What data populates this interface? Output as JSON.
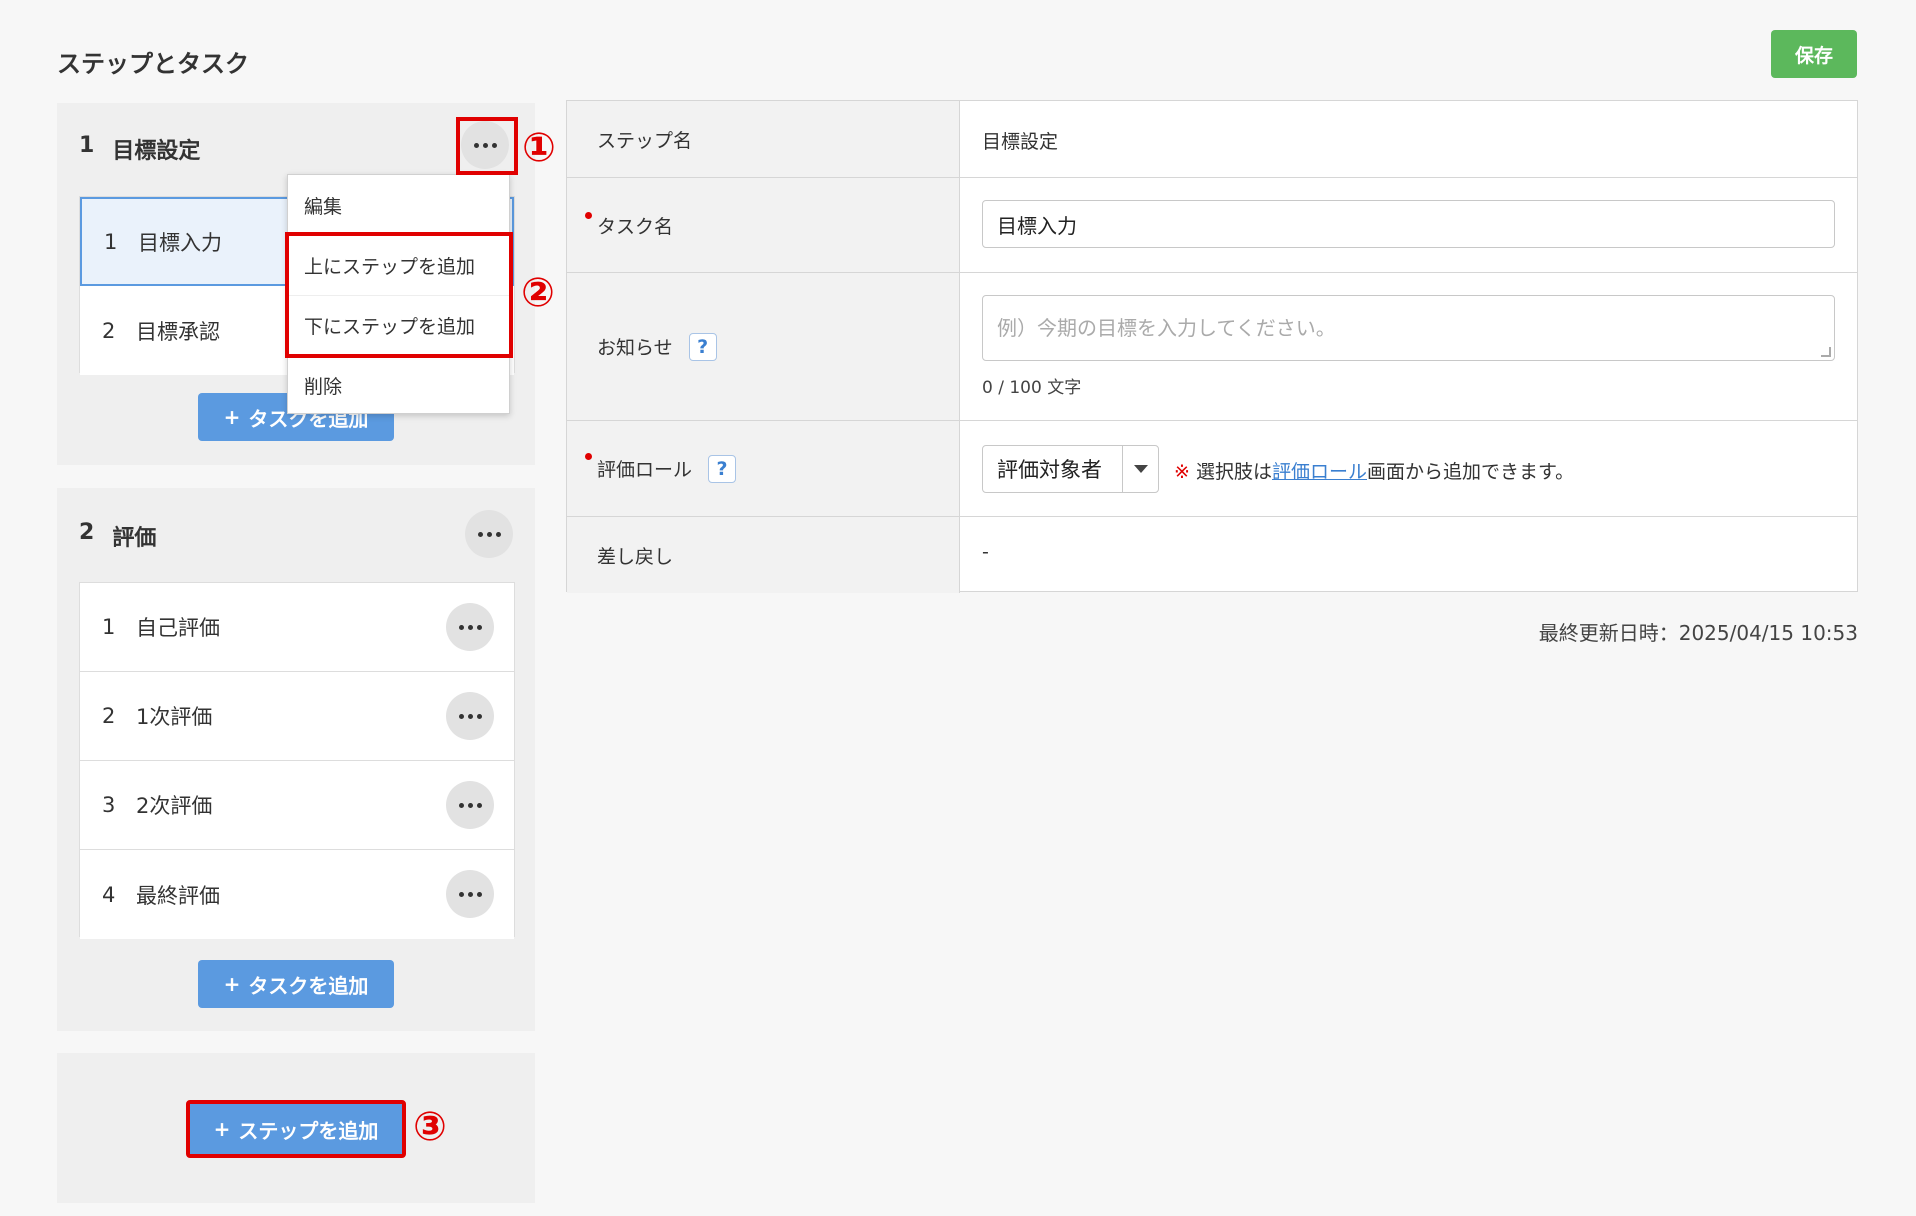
{
  "page": {
    "title": "ステップとタスク",
    "save_label": "保存",
    "updated": "最終更新日時：2025/04/15 10:53"
  },
  "steps": [
    {
      "number": "1",
      "name": "目標設定",
      "tasks": [
        {
          "number": "1",
          "name": "目標入力"
        },
        {
          "number": "2",
          "name": "目標承認"
        }
      ],
      "add_task_label": "タスクを追加"
    },
    {
      "number": "2",
      "name": "評価",
      "tasks": [
        {
          "number": "1",
          "name": "自己評価"
        },
        {
          "number": "2",
          "name": "1次評価"
        },
        {
          "number": "3",
          "name": "2次評価"
        },
        {
          "number": "4",
          "name": "最終評価"
        }
      ],
      "add_task_label": "タスクを追加"
    }
  ],
  "add_step_label": "ステップを追加",
  "plus_symbol": "+",
  "context_menu": [
    "編集",
    "上にステップを追加",
    "下にステップを追加",
    "削除"
  ],
  "callouts": [
    "①",
    "②",
    "③"
  ],
  "form": {
    "step_name_label": "ステップ名",
    "step_name_value": "目標設定",
    "task_name_label": "タスク名",
    "task_name_value": "目標入力",
    "notice_label": "お知らせ",
    "notice_placeholder": "例）今期の目標を入力してください。",
    "notice_count": "0 / 100 文字",
    "role_label": "評価ロール",
    "role_value": "評価対象者",
    "role_note_mark": "※",
    "role_note_pre": "選択肢は",
    "role_note_link": "評価ロール",
    "role_note_post": "画面から追加できます。",
    "sendback_label": "差し戻し",
    "sendback_value": "-",
    "help_symbol": "?"
  },
  "colors": {
    "save": "#5cb85c",
    "primary": "#5b9ae0",
    "highlight": "#e00000"
  }
}
